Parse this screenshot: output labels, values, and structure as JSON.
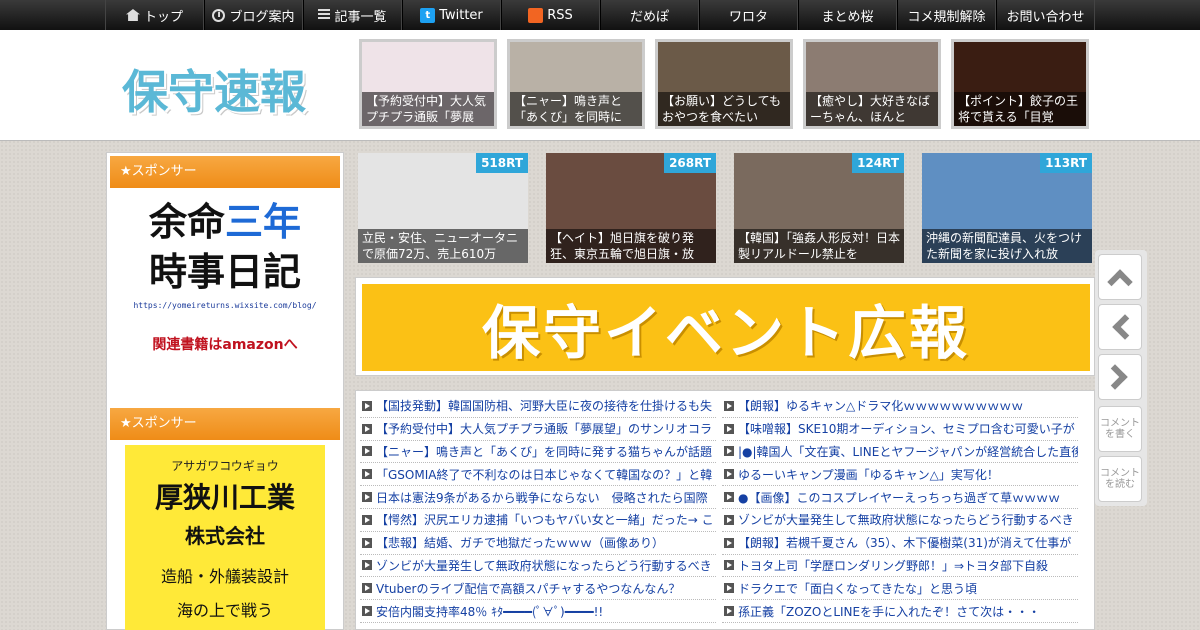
{
  "nav": {
    "items": [
      {
        "label": "トップ",
        "icon": "home-icon"
      },
      {
        "label": "ブログ案内",
        "icon": "info-icon"
      },
      {
        "label": "記事一覧",
        "icon": "list-icon"
      },
      {
        "label": "Twitter",
        "icon": "twitter-icon"
      },
      {
        "label": "RSS",
        "icon": "rss-icon"
      },
      {
        "label": "だめぽ"
      },
      {
        "label": "ワロタ"
      },
      {
        "label": "まとめ桜"
      },
      {
        "label": "コメ規制解除"
      },
      {
        "label": "お問い合わせ"
      }
    ]
  },
  "header": {
    "logo": "保守速報",
    "thumbs": [
      {
        "caption": "【予約受付中】大人気プチプラ通販「夢展望」",
        "color": "#efe3e8"
      },
      {
        "caption": "【ニャー】鳴き声と「あくび」を同時に",
        "color": "#b9b1a6"
      },
      {
        "caption": "【お願い】どうしてもおやつを食べたい",
        "color": "#6b5a48"
      },
      {
        "caption": "【癒やし】大好きなばーちゃん、ほんと",
        "color": "#8c7c72"
      },
      {
        "caption": "【ポイント】餃子の王将で貰える「目覚",
        "color": "#3a1d12"
      }
    ]
  },
  "sidebar": {
    "sponsor_label": "★スポンサー",
    "ad1": {
      "line1a": "余命",
      "line1b": "三年",
      "line2": "時事日記",
      "url": "https://yomeireturns.wixsite.com/blog/",
      "amazon": "関連書籍はamazonへ"
    },
    "sponsor_label2": "★スポンサー",
    "ad2": {
      "kana": "アサガワコウギョウ",
      "name": "厚狭川工業",
      "corp": "株式会社",
      "desc": "造船・外艤装設計",
      "tail": "海の上で戦う"
    }
  },
  "rt_items": [
    {
      "badge": "518RT",
      "caption": "立民・安住、ニューオータニで原価72万、売上610万",
      "color": "#e4e4e4"
    },
    {
      "badge": "268RT",
      "caption": "【ヘイト】旭日旗を破り発狂、東京五輪で旭日旗・放",
      "color": "#6a4c40"
    },
    {
      "badge": "124RT",
      "caption": "【韓国】「強姦人形反対！日本製リアルドール禁止を",
      "color": "#7a6a5e"
    },
    {
      "badge": "113RT",
      "caption": "沖縄の新聞配達員、火をつけた新聞を家に投げ入れ放",
      "color": "#5f8fc2"
    }
  ],
  "banner": {
    "text": "保守イベント広報"
  },
  "list": {
    "left": [
      "【国技発動】韓国国防相、河野大臣に夜の接待を仕掛けるも失",
      "【予約受付中】大人気プチプラ通販「夢展望」のサンリオコラ",
      "【ニャー】鳴き声と「あくび」を同時に発する猫ちゃんが話題",
      "「GSOMIA終了で不利なのは日本じゃなくて韓国なの？」と韓",
      "日本は憲法9条があるから戦争にならない　侵略されたら国際",
      "【愕然】沢尻エリカ逮捕「いつもヤバい女と一緒」だった→ こ",
      "【悲報】結婚、ガチで地獄だったｗｗｗ（画像あり）",
      "ゾンビが大量発生して無政府状態になったらどう行動するべき",
      "Vtuberのライブ配信で高額スパチャするやつなんなん？",
      "安倍内閣支持率48％ ｷﾀ━━━━(ﾟ∀ﾟ)━━━━!!"
    ],
    "right": [
      "【朗報】ゆるキャン△ドラマ化ｗｗｗｗｗｗｗｗｗｗ",
      "【味噌報】SKE10期オーディション、セミプロ含む可愛い子が",
      "|●|韓国人「文在寅、LINEとヤフージャパンが経営統合した直後",
      "ゆるーいキャンプ漫画「ゆるキャン△」実写化！",
      "●【画像】このコスプレイヤーえっちっち過ぎて草ｗｗｗｗ",
      "ゾンビが大量発生して無政府状態になったらどう行動するべき",
      "【朗報】若槻千夏さん（35）、木下優樹菜(31)が消えて仕事が",
      "トヨタ上司「学歴ロンダリング野郎！」⇒トヨタ部下自殺",
      "ドラクエで「面白くなってきたな」と思う頃",
      "孫正義「ZOZOとLINEを手に入れたぞ！さて次は・・・"
    ]
  },
  "side": {
    "up": "up-arrow",
    "back": "left-arrow",
    "forward": "right-arrow",
    "comment_write": "コメントを書く",
    "comment_read": "コメントを読む"
  }
}
